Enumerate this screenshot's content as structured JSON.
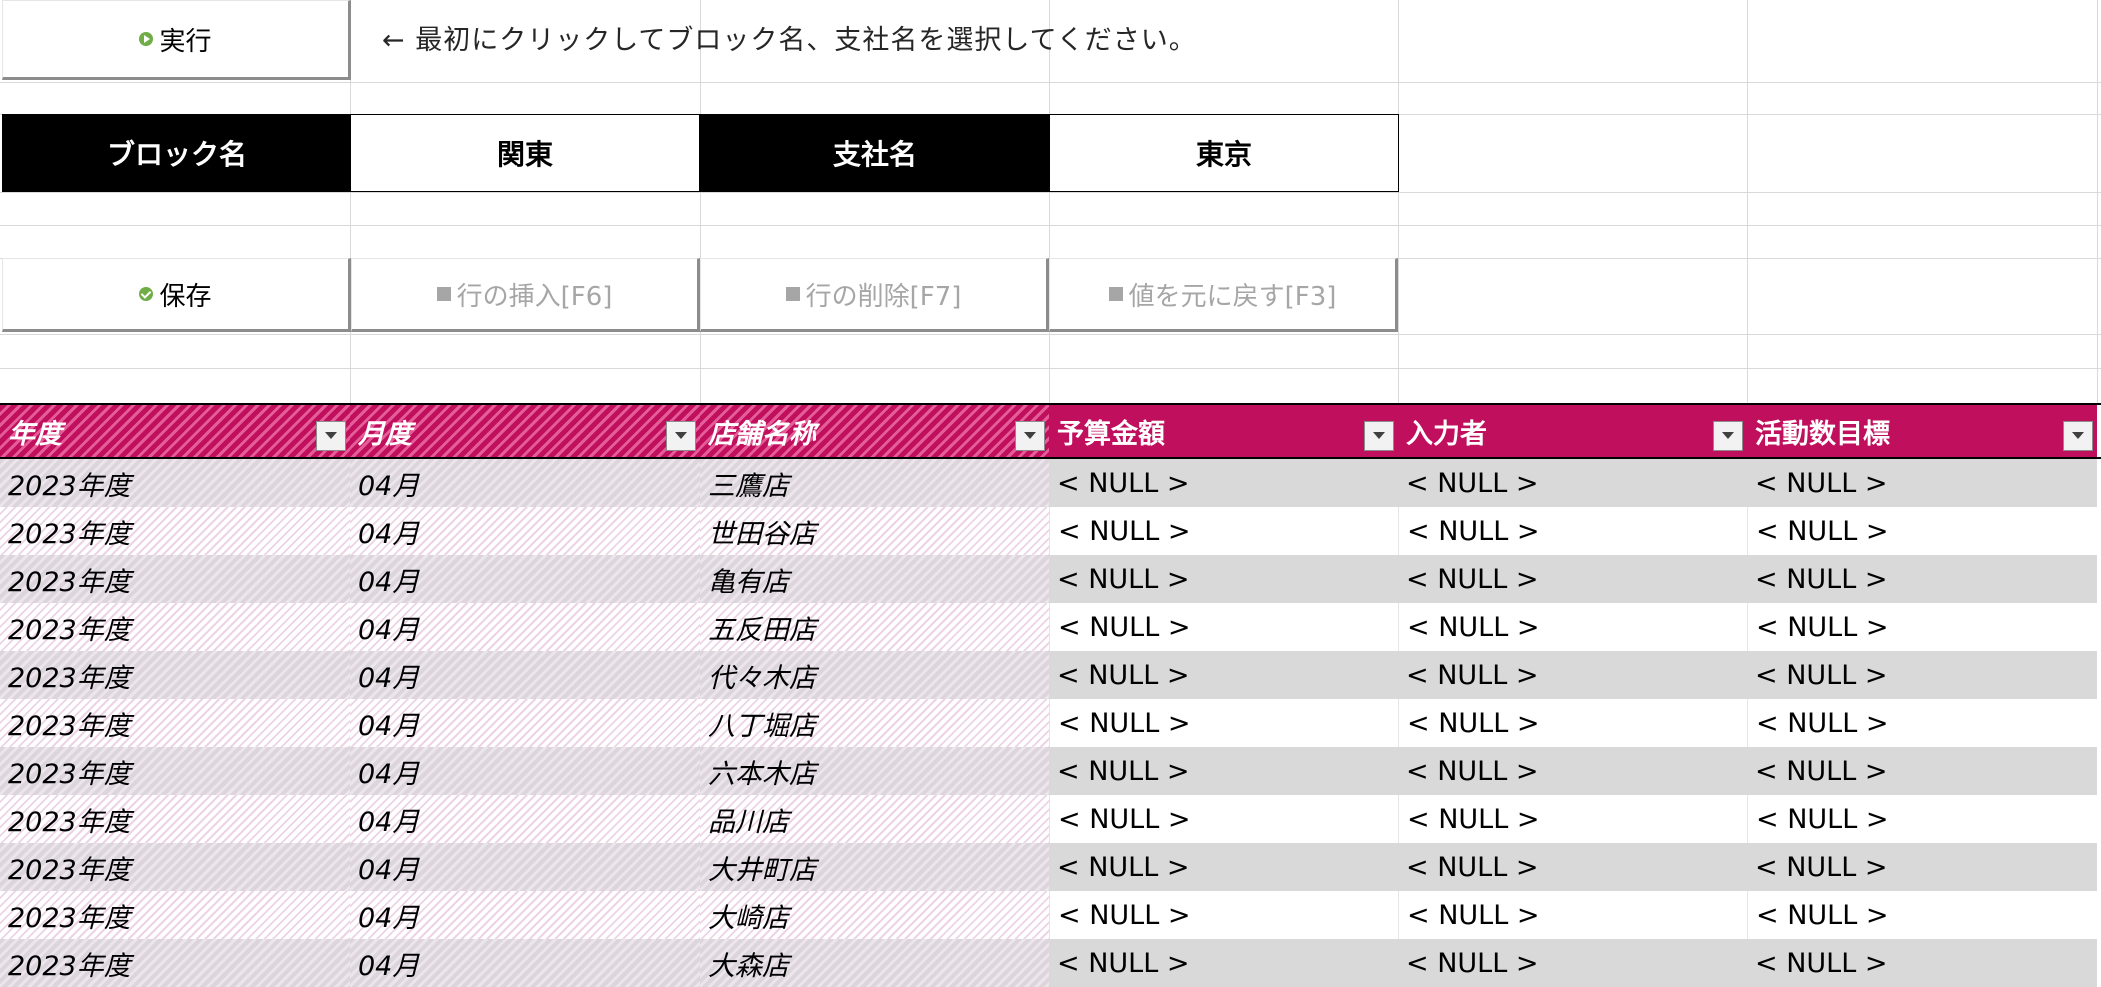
{
  "toolbar": {
    "run_label": "実行",
    "instruction": "← 最初にクリックしてブロック名、支社名を選択してください。",
    "save_label": "保存",
    "insert_row_label": "行の挿入[F6]",
    "delete_row_label": "行の削除[F7]",
    "revert_label": "値を元に戻す[F3]"
  },
  "selection": {
    "block_label": "ブロック名",
    "block_value": "関東",
    "branch_label": "支社名",
    "branch_value": "東京"
  },
  "table": {
    "headers": [
      "年度",
      "月度",
      "店舗名称",
      "予算金額",
      "入力者",
      "活動数目標"
    ],
    "rows": [
      [
        "2023年度",
        "04月",
        "三鷹店",
        "< NULL >",
        "< NULL >",
        "< NULL >"
      ],
      [
        "2023年度",
        "04月",
        "世田谷店",
        "< NULL >",
        "< NULL >",
        "< NULL >"
      ],
      [
        "2023年度",
        "04月",
        "亀有店",
        "< NULL >",
        "< NULL >",
        "< NULL >"
      ],
      [
        "2023年度",
        "04月",
        "五反田店",
        "< NULL >",
        "< NULL >",
        "< NULL >"
      ],
      [
        "2023年度",
        "04月",
        "代々木店",
        "< NULL >",
        "< NULL >",
        "< NULL >"
      ],
      [
        "2023年度",
        "04月",
        "八丁堀店",
        "< NULL >",
        "< NULL >",
        "< NULL >"
      ],
      [
        "2023年度",
        "04月",
        "六本木店",
        "< NULL >",
        "< NULL >",
        "< NULL >"
      ],
      [
        "2023年度",
        "04月",
        "品川店",
        "< NULL >",
        "< NULL >",
        "< NULL >"
      ],
      [
        "2023年度",
        "04月",
        "大井町店",
        "< NULL >",
        "< NULL >",
        "< NULL >"
      ],
      [
        "2023年度",
        "04月",
        "大崎店",
        "< NULL >",
        "< NULL >",
        "< NULL >"
      ],
      [
        "2023年度",
        "04月",
        "大森店",
        "< NULL >",
        "< NULL >",
        "< NULL >"
      ]
    ]
  },
  "colors": {
    "header_accent": "#c00f5d",
    "run_icon": "#70ad47",
    "disabled_text": "#a6a6a6"
  },
  "icons": {
    "run": "play-circle-icon",
    "save": "check-circle-icon",
    "disabled": "square-icon",
    "filter": "dropdown-filter-icon"
  }
}
